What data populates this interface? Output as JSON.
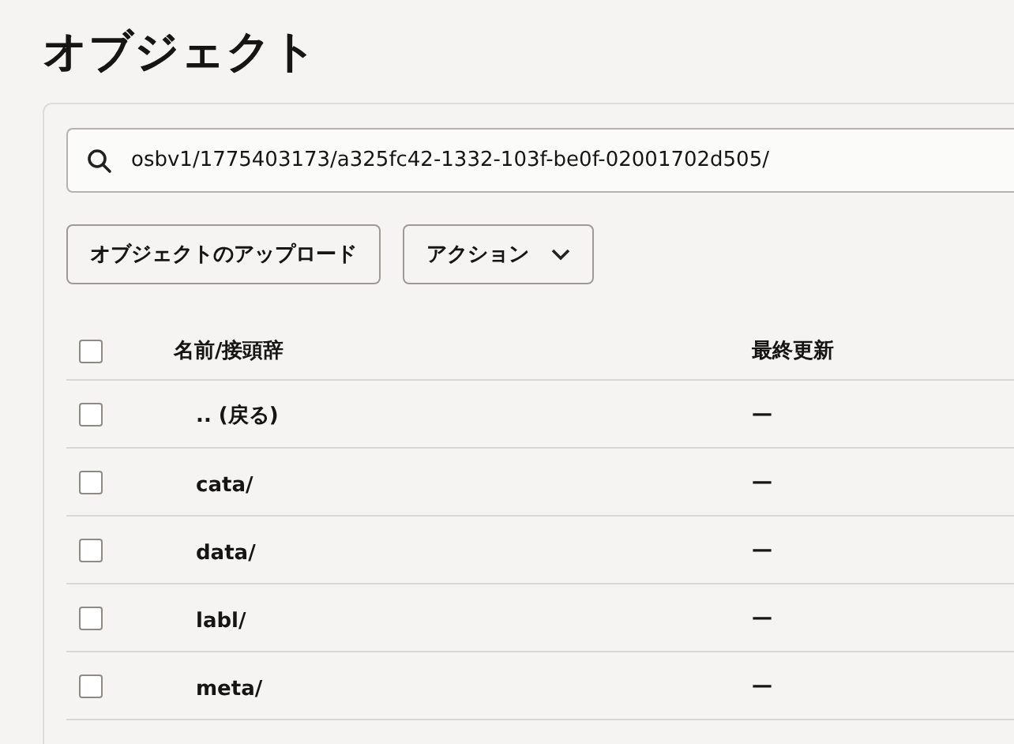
{
  "page": {
    "title": "オブジェクト"
  },
  "search": {
    "value": "osbv1/1775403173/a325fc42-1332-103f-be0f-02001702d505/"
  },
  "buttons": [
    {
      "label": "オブジェクトのアップロード",
      "kind": "plain"
    },
    {
      "label": "アクション",
      "kind": "menu"
    }
  ],
  "table": {
    "select_all": {
      "checked": false
    },
    "columns": [
      "名前/接頭辞",
      "最終更新"
    ],
    "rows": [
      {
        "name": ".. (戻る)",
        "modified": "—",
        "checked": false
      },
      {
        "name": "cata/",
        "modified": "—",
        "checked": false
      },
      {
        "name": "data/",
        "modified": "—",
        "checked": false
      },
      {
        "name": "labl/",
        "modified": "—",
        "checked": false
      },
      {
        "name": "meta/",
        "modified": "—",
        "checked": false
      }
    ]
  }
}
